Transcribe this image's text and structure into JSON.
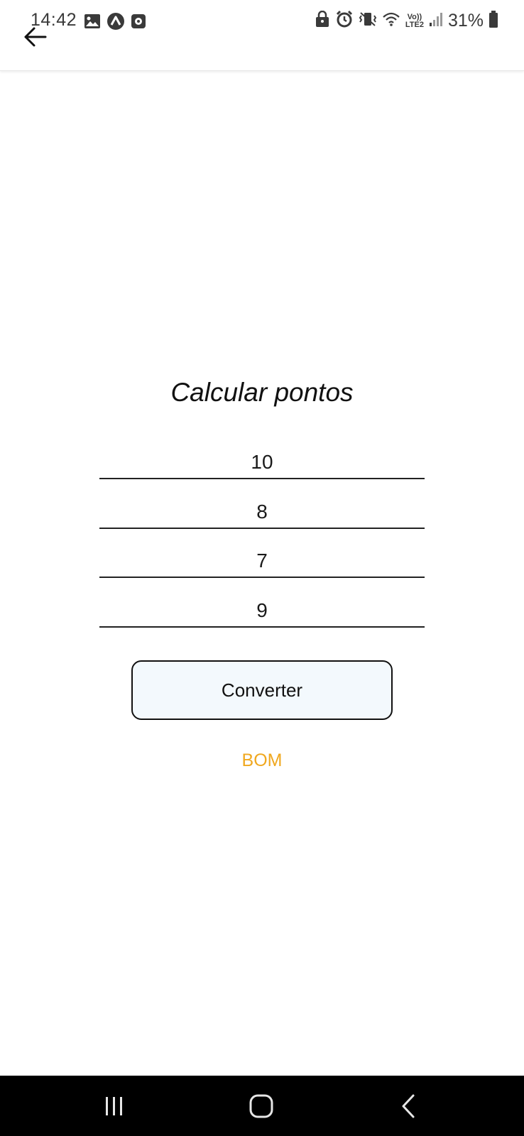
{
  "status_bar": {
    "time": "14:42",
    "battery_percent": "31%",
    "network_label_top": "Vo))",
    "network_label_bottom": "LTE2",
    "left_icons": [
      "gallery-icon",
      "app-a-icon",
      "media-icon"
    ],
    "right_icons": [
      "lock-icon",
      "alarm-icon",
      "vibrate-icon",
      "wifi-icon",
      "signal-icon",
      "battery-icon"
    ]
  },
  "app_bar": {
    "back_icon": "arrow-left-icon"
  },
  "main": {
    "title": "Calcular pontos",
    "fields": [
      {
        "value": "10"
      },
      {
        "value": "8"
      },
      {
        "value": "7"
      },
      {
        "value": "9"
      }
    ],
    "convert_label": "Converter",
    "result_text": "BOM",
    "result_color": "#f0a81f"
  },
  "nav_bar": {
    "icons": [
      "recents-icon",
      "home-icon",
      "back-icon"
    ]
  }
}
